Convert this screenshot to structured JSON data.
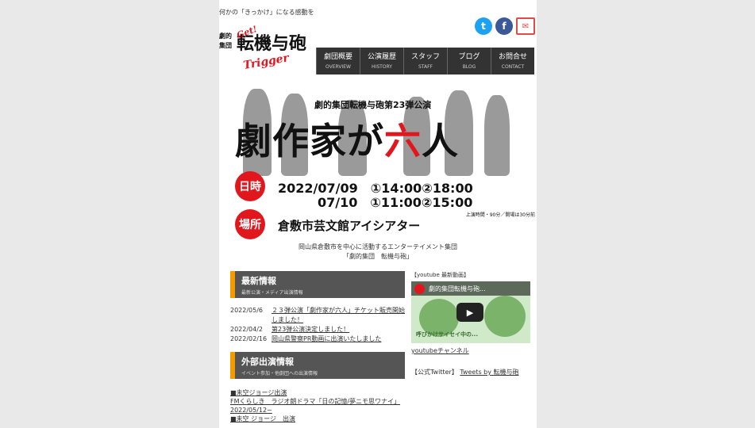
{
  "header": {
    "tagline": "何かの「きっかけ」になる感動を",
    "logo": {
      "text": "転機与砲",
      "prefix": "劇団集団",
      "script": "Trigger"
    },
    "social": [
      {
        "name": "twitter",
        "glyph": "t"
      },
      {
        "name": "facebook",
        "glyph": "f"
      },
      {
        "name": "mail",
        "glyph": "✉"
      }
    ]
  },
  "nav": [
    {
      "jp": "劇団概要",
      "en": "OVERVIEW"
    },
    {
      "jp": "公演履歴",
      "en": "HISTORY"
    },
    {
      "jp": "スタッフ",
      "en": "STAFF"
    },
    {
      "jp": "ブログ",
      "en": "BLOG"
    },
    {
      "jp": "お問合せ",
      "en": "CONTACT"
    }
  ],
  "hero": {
    "subtitle": "劇的集団転機与砲第23弾公演",
    "title_a": "劇作家が",
    "title_red": "六",
    "title_b": "人",
    "badge_date": "日時",
    "badge_venue": "場所",
    "date1": "2022/07/09　①14:00②18:00",
    "date2": "07/10　①11:00②15:00",
    "note": "上演時間・90分／開場は30分前",
    "venue": "倉敷市芸文館アイシアター"
  },
  "intro": {
    "line1": "岡山県倉敷市を中心に活動するエンターテイメント集団",
    "line2": "「劇的集団　転機与砲」"
  },
  "news_section": {
    "title": "最新情報",
    "subtitle": "最新公演・メディア出演情報",
    "items": [
      {
        "date": "2022/05/6",
        "text": "２３弾公演「劇作家が六人」チケット販売開始しました！"
      },
      {
        "date": "2022/04/2",
        "text": "第23弾公演決定しました！"
      },
      {
        "date": "2022/02/16",
        "text": "岡山県警察PR動画に出演いたしました"
      }
    ]
  },
  "external_section": {
    "title": "外部出演情報",
    "subtitle": "イベント参加・他劇団への出演情報",
    "lines": [
      "■未空ジョージ出演",
      "FMくらしき　ラジオ朗ドラマ「日の記憶/夢ニモ思ワナイ」",
      "2022/05/12~",
      "■未空 ジョージ　出演"
    ]
  },
  "sidebar": {
    "youtube_label": "【youtube 最新動画】",
    "video_title": "劇的集団転機与砲...",
    "video_caption": "呼びかけサイセイ中の...",
    "youtube_link": "youtubeチャンネル",
    "twitter_label": "【公式Twitter】",
    "twitter_link": "Tweets by 転機与砲"
  }
}
